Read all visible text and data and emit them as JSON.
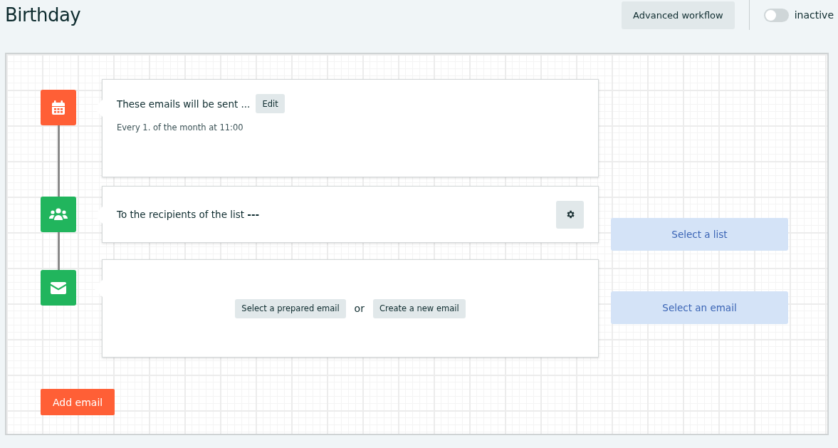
{
  "header": {
    "title": "Birthday",
    "advanced_button": "Advanced workflow",
    "status_toggle": {
      "on": false,
      "label": "inactive"
    }
  },
  "steps": [
    {
      "kind": "schedule",
      "color": "#ff5f36",
      "title": "These emails will be sent ...",
      "edit_button": "Edit",
      "detail": "Every 1. of the month at 11:00"
    },
    {
      "kind": "recipients",
      "color": "#21b55d",
      "title": "To the recipients of the list **---**",
      "side_button": "Select a list"
    },
    {
      "kind": "email",
      "color": "#21b55d",
      "choice_a": "Select a prepared email",
      "separator": "or",
      "choice_b": "Create a new email",
      "side_button": "Select an email"
    }
  ],
  "add_button": "Add email"
}
